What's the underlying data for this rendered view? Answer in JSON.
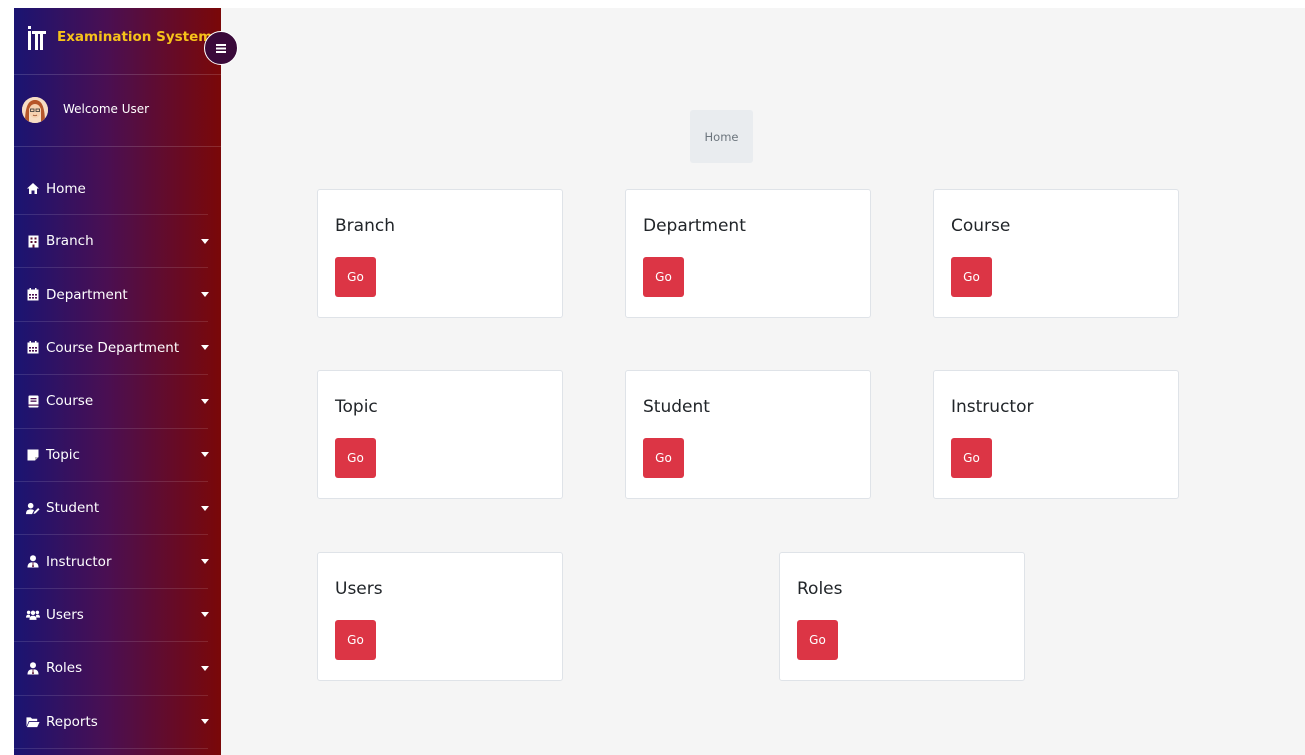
{
  "app": {
    "title": "Examination System",
    "toggle_icon": "menu-icon"
  },
  "user": {
    "welcome": "Welcome User"
  },
  "sidebar": {
    "items": [
      {
        "label": "Home",
        "icon": "home-icon",
        "has_caret": false
      },
      {
        "label": "Branch",
        "icon": "building-icon",
        "has_caret": true
      },
      {
        "label": "Department",
        "icon": "calendar-icon",
        "has_caret": true
      },
      {
        "label": "Course Department",
        "icon": "calendar-icon",
        "has_caret": true
      },
      {
        "label": "Course",
        "icon": "book-icon",
        "has_caret": true
      },
      {
        "label": "Topic",
        "icon": "sticky-note-icon",
        "has_caret": true
      },
      {
        "label": "Student",
        "icon": "user-edit-icon",
        "has_caret": true
      },
      {
        "label": "Instructor",
        "icon": "user-tie-icon",
        "has_caret": true
      },
      {
        "label": "Users",
        "icon": "users-icon",
        "has_caret": true
      },
      {
        "label": "Roles",
        "icon": "user-tie-icon",
        "has_caret": true
      },
      {
        "label": "Reports",
        "icon": "folder-open-icon",
        "has_caret": true
      }
    ]
  },
  "breadcrumb": {
    "current": "Home"
  },
  "cards": [
    {
      "title": "Branch",
      "button": "Go"
    },
    {
      "title": "Department",
      "button": "Go"
    },
    {
      "title": "Course",
      "button": "Go"
    },
    {
      "title": "Topic",
      "button": "Go"
    },
    {
      "title": "Student",
      "button": "Go"
    },
    {
      "title": "Instructor",
      "button": "Go"
    },
    {
      "title": "Users",
      "button": "Go"
    },
    {
      "title": "Roles",
      "button": "Go"
    }
  ],
  "colors": {
    "brand_title": "#f6c21a",
    "go_button": "#dc3545",
    "sidebar_start": "#1a1472",
    "sidebar_end": "#7a0808"
  }
}
